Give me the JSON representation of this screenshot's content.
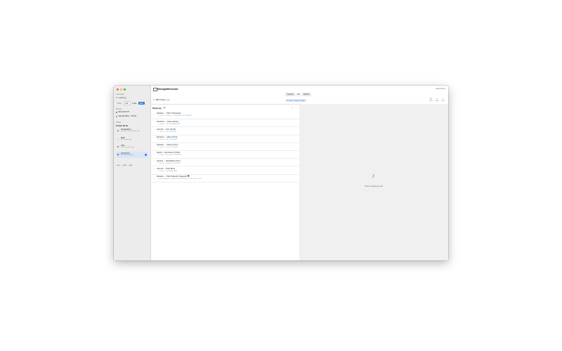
{
  "window": {
    "title": "MonogatMessman",
    "clear_all": "Clear History"
  },
  "sidebar": {
    "section_connection": "Connection",
    "connection_status": "Learning",
    "mode_label": "Mode",
    "tabs": [
      "Midi",
      "Audio",
      "Both"
    ],
    "active_tab": "Both",
    "section_devices": "Devices",
    "devices": [
      "Monoverb FX",
      "Sample Bass · 2 B S4"
    ],
    "section_output": "Output",
    "output_heading": "Output Mode",
    "outputs": [
      {
        "title": "Visualisation",
        "subtitle": "No output · visualization only"
      },
      {
        "title": "MIDI",
        "subtitle": "MIDI output only"
      },
      {
        "title": "OSC",
        "subtitle": "OSC to another app"
      },
      {
        "title": "All Outputs",
        "subtitle": "All outputs enabled"
      }
    ],
    "tags": [
      "● 12",
      "● 234",
      "● 48"
    ]
  },
  "top": {
    "segments": [
      "Sources",
      "Midi",
      "Monitor"
    ],
    "active_segment": "Midi",
    "midi_output_label": "MIDI Output",
    "trigger_button": "Show Trigger Settings",
    "tool_icons": [
      "Mute",
      "Solo",
      "Panic"
    ]
  },
  "list": {
    "title": "Mappings",
    "count": "10",
    "actions": [
      "+",
      "−"
    ],
    "rows": [
      {
        "title": "Distance → Pitch (Transpose)",
        "detail": "Controls · Distance → Range",
        "link": "Pitch: C2 - B2 (0-75)"
      },
      {
        "title": "PointFive → Noise Velocity",
        "detail": "Controls · Velocity",
        "link": "Velocity 0-127"
      },
      {
        "title": "Azimuth → Pan (CC10)",
        "detail": "Controls · Pan",
        "link": "CC10 0-127"
      },
      {
        "title": "Elevation → Filter (CC74)",
        "detail": "Controls · Filter",
        "link": "CC74 0-127"
      },
      {
        "title": "Distance → Volume (CC7)",
        "detail": "Controls · Volume",
        "link": "CC7 0-127"
      },
      {
        "title": "Speed → Expression (CC11)",
        "detail": "Controls · Expression",
        "link": "CC11 0-127"
      },
      {
        "title": "Gesture → Modulation (CC1)",
        "detail": "Controls · Modulation",
        "link": "CC1 0-127"
      },
      {
        "title": "Azimuth → Pitch Bend",
        "detail": "Controls · Pitch",
        "link": "Bend ±8192"
      },
      {
        "title": "Distance → Pitch (Velocity Triggered) 🎹",
        "detail": "Velocity triggered · Trigger when the distance crosses",
        "link": "60 · 0 - 127"
      }
    ]
  },
  "detail": {
    "empty_text": "Select a mapping to edit"
  }
}
